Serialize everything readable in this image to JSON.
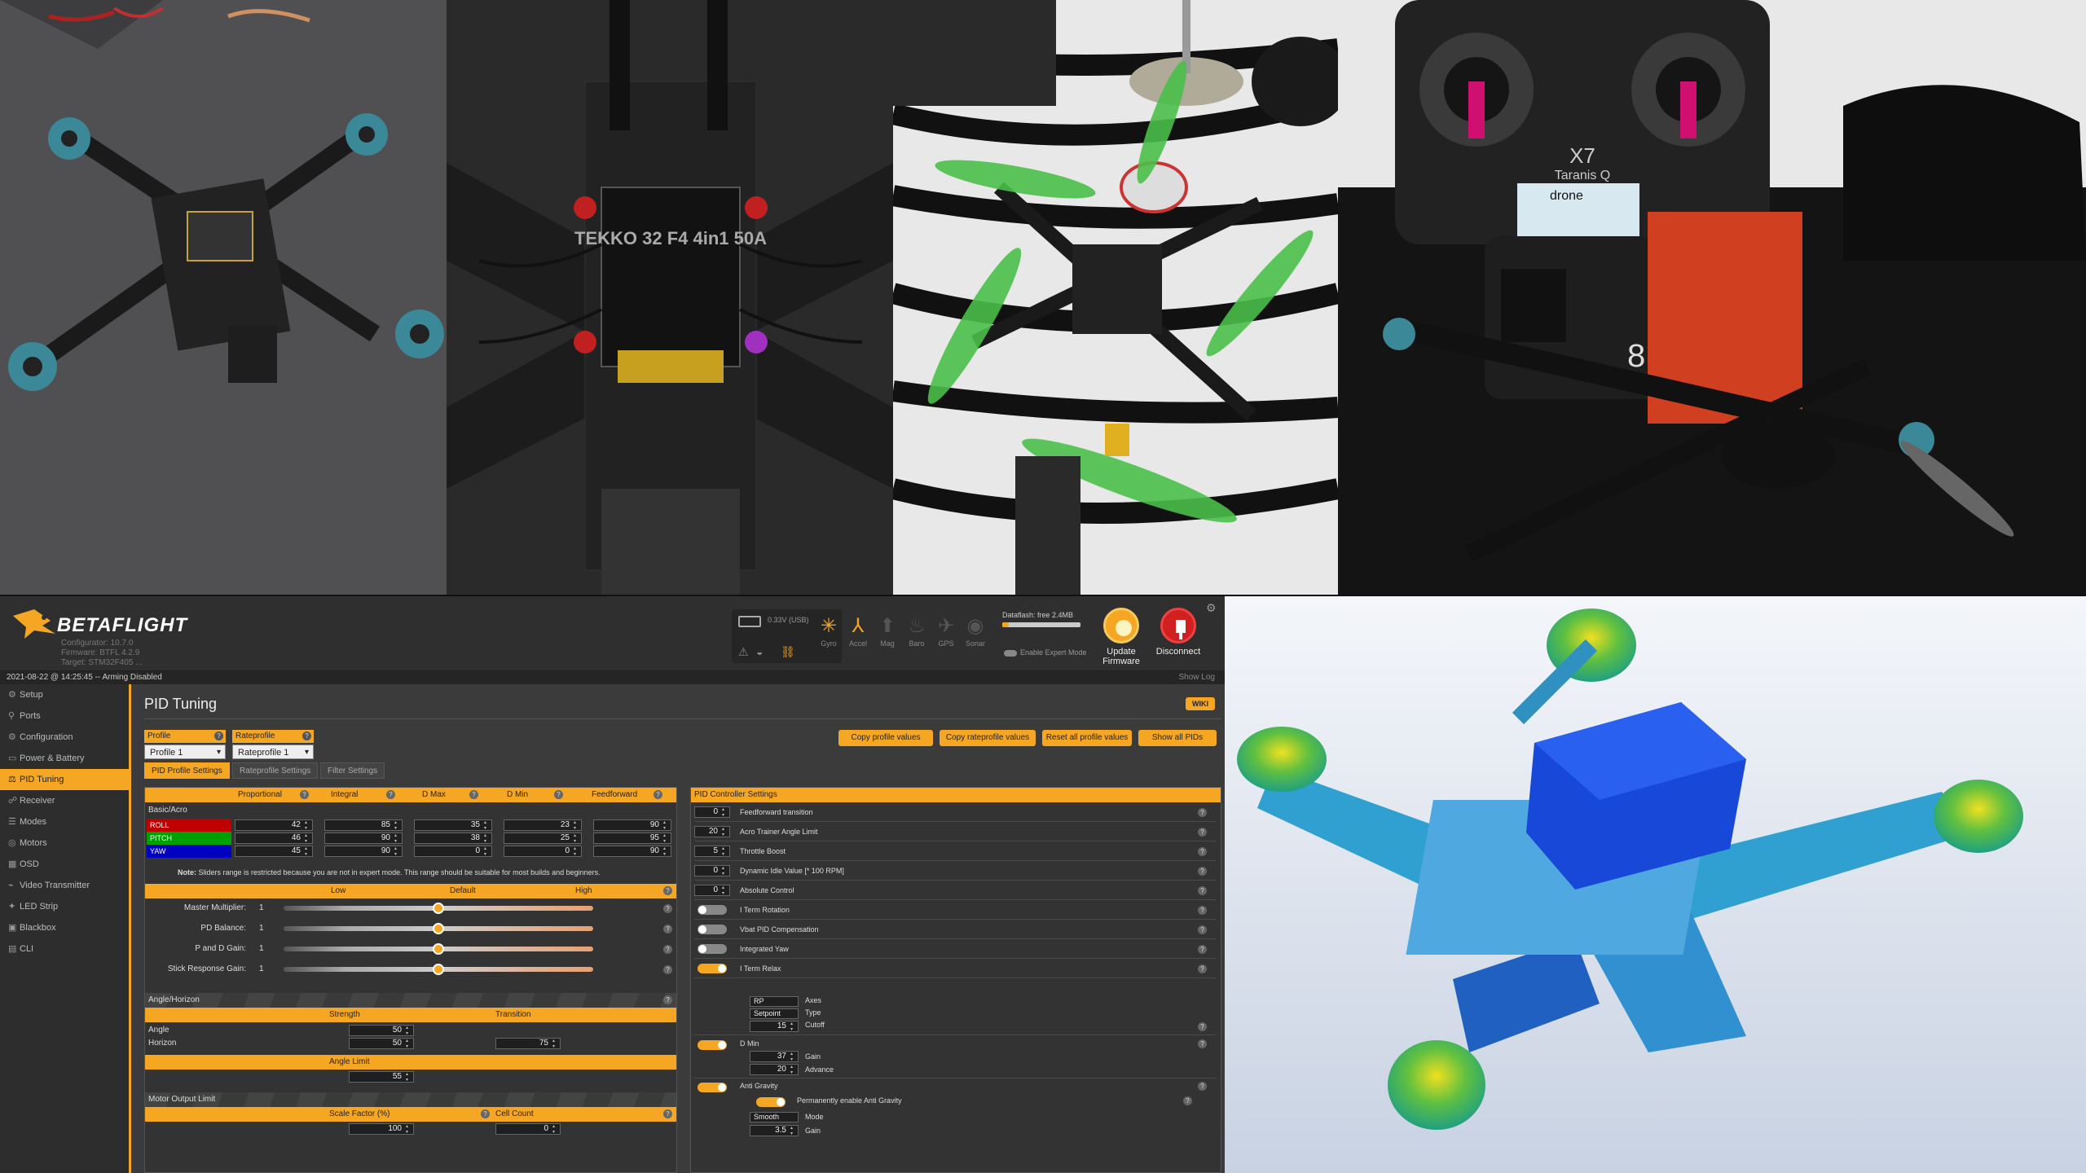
{
  "photos": [
    {
      "name": "frame-assembly-photo"
    },
    {
      "name": "esc-closeup-photo",
      "esc_text": "TEKKO 32 F4 4in1 50A"
    },
    {
      "name": "build-in-progress-photo"
    },
    {
      "name": "finished-quad-photo",
      "radio_model": "X7",
      "radio_brand": "Taranis Q",
      "radio_screen": "drone",
      "camera_label": "8"
    },
    {
      "name": "stress-simulation-render"
    }
  ],
  "betaflight": {
    "brand": "BETAFLIGHT",
    "configurator": "Configurator: 10.7.0",
    "firmware": "Firmware: BTFL 4.2.9",
    "target": "Target: STM32F405 ...",
    "battery_label": "0.33V (USB)",
    "sensors": [
      "Gyro",
      "Accel",
      "Mag",
      "Baro",
      "GPS",
      "Sonar"
    ],
    "dataflash": "Dataflash: free 2.4MB",
    "expert_mode": "Enable Expert Mode",
    "update_firmware": "Update Firmware",
    "disconnect": "Disconnect",
    "status": "2021-08-22 @ 14:25:45 -- Arming Disabled",
    "show_log": "Show Log",
    "nav": [
      {
        "label": "Setup",
        "icon": "wrench-icon",
        "glyph": "⚙"
      },
      {
        "label": "Ports",
        "icon": "plug-icon",
        "glyph": "⚲"
      },
      {
        "label": "Configuration",
        "icon": "gear-icon",
        "glyph": "⚙"
      },
      {
        "label": "Power & Battery",
        "icon": "battery-icon",
        "glyph": "▭"
      },
      {
        "label": "PID Tuning",
        "icon": "tuning-icon",
        "glyph": "⚖"
      },
      {
        "label": "Receiver",
        "icon": "antenna-icon",
        "glyph": "☍"
      },
      {
        "label": "Modes",
        "icon": "modes-icon",
        "glyph": "☰"
      },
      {
        "label": "Motors",
        "icon": "motor-icon",
        "glyph": "◎"
      },
      {
        "label": "OSD",
        "icon": "osd-icon",
        "glyph": "▦"
      },
      {
        "label": "Video Transmitter",
        "icon": "vtx-icon",
        "glyph": "⌁"
      },
      {
        "label": "LED Strip",
        "icon": "led-icon",
        "glyph": "✦"
      },
      {
        "label": "Blackbox",
        "icon": "blackbox-icon",
        "glyph": "▣"
      },
      {
        "label": "CLI",
        "icon": "cli-icon",
        "glyph": "▤"
      }
    ],
    "page_title": "PID Tuning",
    "wiki": "WIKI",
    "profile_label": "Profile",
    "profile_value": "Profile 1",
    "rateprofile_label": "Rateprofile",
    "rateprofile_value": "Rateprofile 1",
    "buttons": [
      "Copy profile values",
      "Copy rateprofile values",
      "Reset all profile values",
      "Show all PIDs"
    ],
    "tabs": [
      "PID Profile Settings",
      "Rateprofile Settings",
      "Filter Settings"
    ],
    "pid_headers": [
      "Proportional",
      "Integral",
      "D Max",
      "D Min",
      "Feedforward"
    ],
    "basic_acro": "Basic/Acro",
    "pid_rows": [
      {
        "name": "ROLL",
        "color": "#c00000",
        "values": [
          "42",
          "85",
          "35",
          "23",
          "90"
        ]
      },
      {
        "name": "PITCH",
        "color": "#00a000",
        "values": [
          "46",
          "90",
          "38",
          "25",
          "95"
        ]
      },
      {
        "name": "YAW",
        "color": "#0000c0",
        "values": [
          "45",
          "90",
          "0",
          "0",
          "90"
        ]
      }
    ],
    "note_bold": "Note:",
    "note": "Sliders range is restricted because you are not in expert mode. This range should be suitable for most builds and beginners.",
    "slider_headers": [
      "Low",
      "Default",
      "High"
    ],
    "sliders": [
      {
        "label": "Master Multiplier:",
        "value": "1",
        "level": 0.5
      },
      {
        "label": "PD Balance:",
        "value": "1",
        "level": 0.5
      },
      {
        "label": "P and D Gain:",
        "value": "1",
        "level": 0.5
      },
      {
        "label": "Stick Response Gain:",
        "value": "1",
        "level": 0.5
      }
    ],
    "angle_horizon": "Angle/Horizon",
    "strength": "Strength",
    "transition": "Transition",
    "angle": "Angle",
    "angle_strength": "50",
    "horizon": "Horizon",
    "horizon_strength": "50",
    "horizon_transition": "75",
    "angle_limit": "Angle Limit",
    "angle_limit_value": "55",
    "motor_output_limit": "Motor Output Limit",
    "scale_factor": "Scale Factor (%)",
    "cell_count": "Cell Count",
    "scale_value": "100",
    "cell_value": "0",
    "controller_header": "PID Controller Settings",
    "controller": [
      {
        "type": "num",
        "value": "0",
        "label": "Feedforward transition"
      },
      {
        "type": "num",
        "value": "20",
        "label": "Acro Trainer Angle Limit"
      },
      {
        "type": "num",
        "value": "5",
        "label": "Throttle Boost"
      },
      {
        "type": "num",
        "value": "0",
        "label": "Dynamic Idle Value [* 100 RPM]"
      },
      {
        "type": "num",
        "value": "0",
        "label": "Absolute Control"
      },
      {
        "type": "toggle",
        "on": false,
        "label": "I Term Rotation"
      },
      {
        "type": "toggle",
        "on": false,
        "label": "Vbat PID Compensation"
      },
      {
        "type": "toggle",
        "on": false,
        "label": "Integrated Yaw"
      },
      {
        "type": "toggle",
        "on": true,
        "label": "I Term Relax"
      }
    ],
    "iterm_relax": {
      "axes_sel": "RP",
      "axes": "Axes",
      "type_sel": "Setpoint",
      "type": "Type",
      "cutoff_val": "15",
      "cutoff": "Cutoff"
    },
    "dmin": {
      "label": "D Min",
      "gain_val": "37",
      "gain": "Gain",
      "adv_val": "20",
      "adv": "Advance"
    },
    "antigravity": {
      "label": "Anti Gravity",
      "perm": "Permanently enable Anti Gravity",
      "mode_sel": "Smooth",
      "mode": "Mode",
      "gain_val": "3.5",
      "gain": "Gain"
    }
  }
}
